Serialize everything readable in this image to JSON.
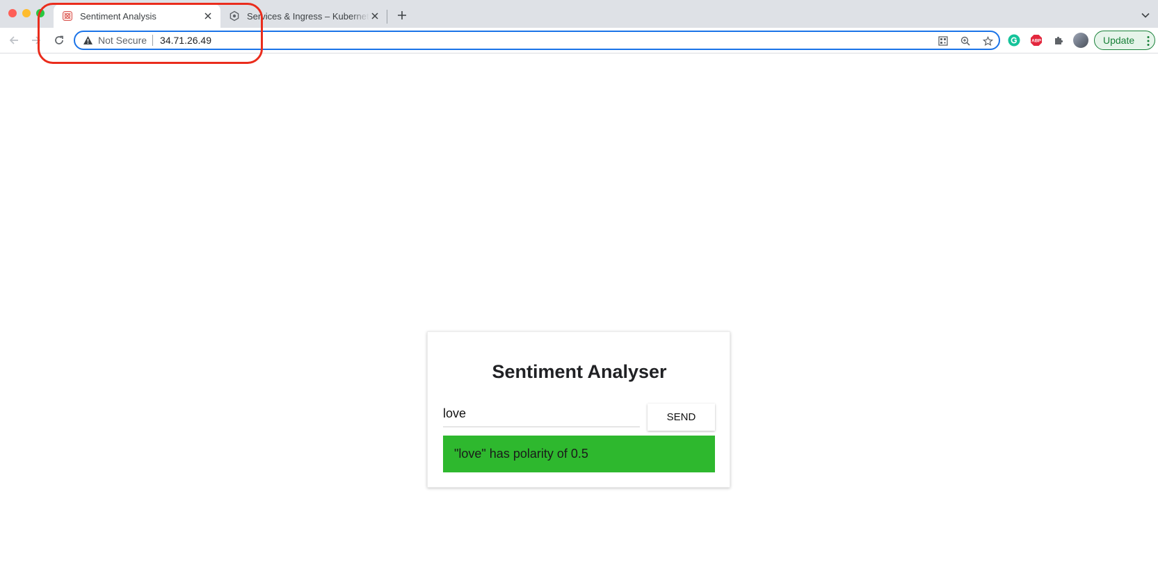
{
  "browser": {
    "tabs": [
      {
        "title": "Sentiment Analysis",
        "active": true
      },
      {
        "title": "Services & Ingress – Kubernetes Engine",
        "active": false
      }
    ],
    "security_label": "Not Secure",
    "url": "34.71.26.49",
    "update_label": "Update",
    "extensions": [
      "grammarly-icon",
      "adblock-plus-icon",
      "extensions-puzzle-icon"
    ],
    "colors": {
      "accent": "#1a73e8",
      "update_green": "#188038",
      "annotation_red": "#ea2c1c"
    }
  },
  "page": {
    "title": "Sentiment Analyser",
    "input_value": "love",
    "send_label": "SEND",
    "result_text": "\"love\" has polarity of 0.5",
    "result_color": "#2eb82e"
  }
}
